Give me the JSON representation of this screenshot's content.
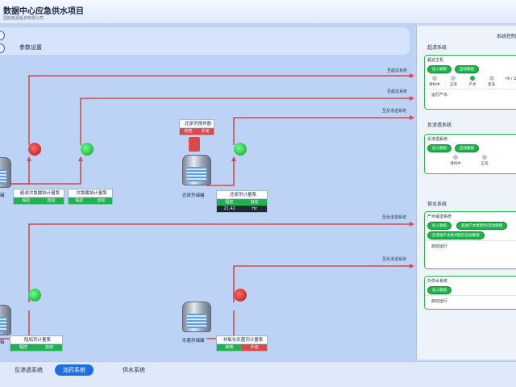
{
  "header": {
    "title": "数据中心应急供水项目",
    "subtitle": "国能能源投资有限公司"
  },
  "param_bar": {
    "label": "参数设置"
  },
  "routes": {
    "r1": "至超滤系统",
    "r2": "至超滤系统",
    "r3": "至反渗透系统",
    "r4": "至反渗透系统",
    "r5": "至反渗透系统"
  },
  "dosing": {
    "title": "还原剂搅拌器",
    "state": "就地",
    "mode": "手动"
  },
  "panels": {
    "p1": {
      "title": "超滤次氯酸钠计量泵",
      "a": "程控",
      "b": "自动"
    },
    "p2": {
      "title": "次氯酸钠计量泵",
      "a": "程控",
      "b": "自动"
    },
    "p3": {
      "title": "还原剂计量泵",
      "a": "程控",
      "b": "自动",
      "value": "21.42",
      "unit": "Hz"
    },
    "p4": {
      "title": "阻垢剂计量泵",
      "a": "程控",
      "b": "自动"
    },
    "p5": {
      "title": "非氧化杀菌剂计量泵",
      "a": "就地",
      "b": "手动"
    }
  },
  "tanks": {
    "t1": "还原剂储罐",
    "t2": "杀菌剂储罐",
    "t_left1": "罐",
    "t_left2": "箱"
  },
  "tabs": {
    "t1": "反渗透系统",
    "t2": "加药系统",
    "t3": "供水系统"
  },
  "side": {
    "title": "系统控制",
    "uf": {
      "section": "超滤系统",
      "card_title": "超滤主机",
      "chip1": "投入联锁",
      "chip2": "自动联锁",
      "dots": [
        "待机中",
        "正洗",
        "产水",
        "反洗"
      ],
      "counter": "•9  / 2",
      "foot": "运行产水"
    },
    "ro": {
      "section": "反渗透系统",
      "card_title": "反渗透系统",
      "chip1": "投入联锁",
      "chip2": "自动联锁",
      "dots": [
        "待机中",
        "正洗"
      ]
    },
    "supply": {
      "section": "供水系统",
      "card_title": "产水输送系统",
      "chip1": "投入联锁",
      "chip2": "超滤产水泵程控/自动联锁",
      "chip3": "反渗透产水泵A程控/自动联锁",
      "foot": "启动运行",
      "card2_title": "外供水系统",
      "chip4": "投入联锁",
      "foot2": "启动运行"
    }
  },
  "colors": {
    "pipe": "#d94a4a",
    "accent": "#1f6fe0",
    "ok": "#1fb24d"
  }
}
